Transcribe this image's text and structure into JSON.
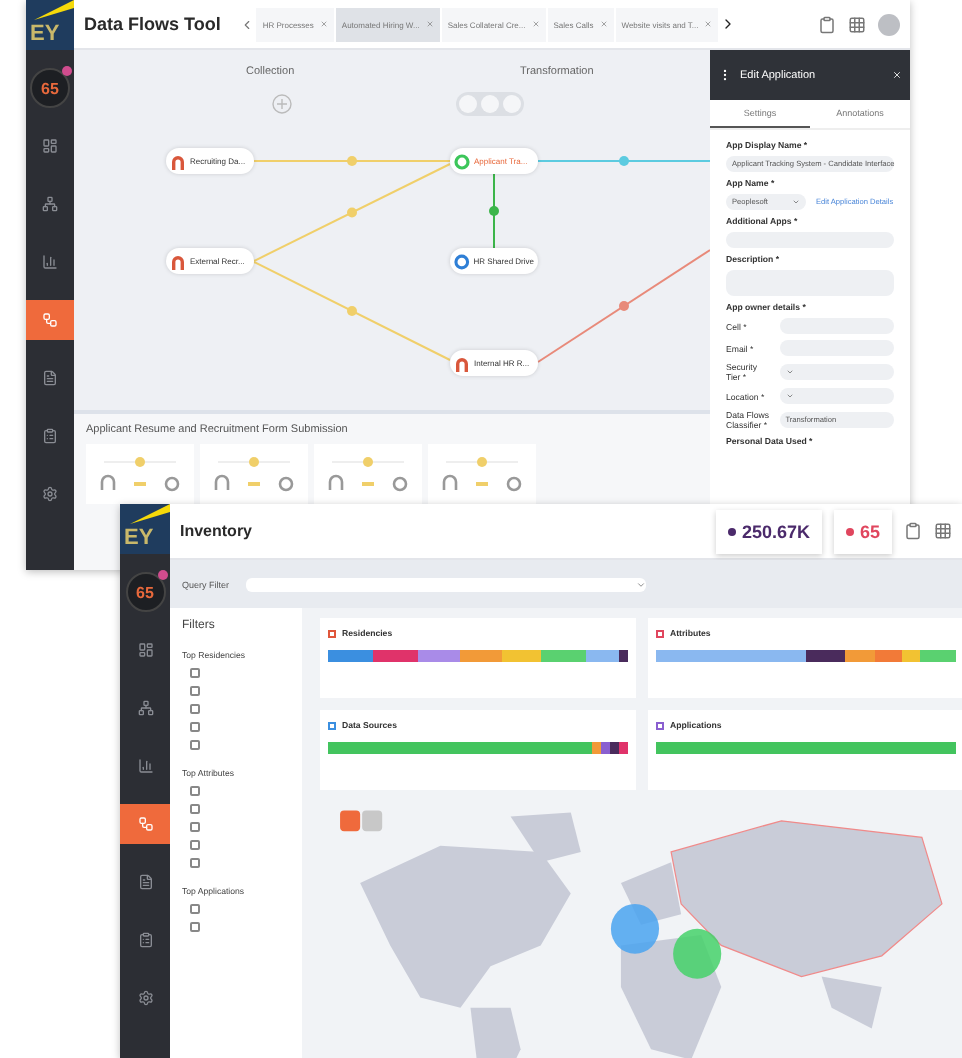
{
  "flows_window": {
    "logo": "EY",
    "badge_count": "65",
    "title": "Data Flows Tool",
    "tabs": [
      {
        "label": "HR Processes",
        "selected": false
      },
      {
        "label": "Automated Hiring W...",
        "selected": true
      },
      {
        "label": "Sales Collateral Cre...",
        "selected": false
      },
      {
        "label": "Sales Calls",
        "selected": false
      },
      {
        "label": "Website visits and T...",
        "selected": false
      }
    ],
    "columns": [
      "Collection",
      "Transformation"
    ],
    "nodes": [
      {
        "label": "Recruiting Da...",
        "kind": "person",
        "color": "#d9573b"
      },
      {
        "label": "Applicant Tra...",
        "kind": "app",
        "color": "#3cc65a"
      },
      {
        "label": "External Recr...",
        "kind": "person",
        "color": "#d9573b"
      },
      {
        "label": "HR Shared Drive",
        "kind": "app",
        "color": "#2f7fd6"
      },
      {
        "label": "Internal HR R...",
        "kind": "person",
        "color": "#d9573b"
      }
    ],
    "edges": [
      {
        "color": "#f0cf6a"
      },
      {
        "color": "#f0cf6a"
      },
      {
        "color": "#f0cf6a"
      },
      {
        "color": "#3cb54a"
      },
      {
        "color": "#5ccbe0"
      },
      {
        "color": "#e88a7a"
      }
    ],
    "panel": {
      "title": "Edit Application",
      "tabs": [
        {
          "label": "Settings",
          "selected": true
        },
        {
          "label": "Annotations",
          "selected": false
        }
      ],
      "fields": [
        {
          "kind": "text",
          "label": "App Display Name *",
          "value": "Applicant Tracking System - Candidate Interface"
        },
        {
          "kind": "select",
          "label": "App Name *",
          "value": "Peoplesoft",
          "link": "Edit Application Details"
        },
        {
          "kind": "text",
          "label": "Additional Apps *"
        },
        {
          "kind": "area",
          "label": "Description *"
        },
        {
          "kind": "heading",
          "label": "App owner details *"
        },
        {
          "kind": "inline",
          "label": "Cell *"
        },
        {
          "kind": "inline",
          "label": "Email *"
        },
        {
          "kind": "inline-select",
          "label": "Security Tier *"
        },
        {
          "kind": "inline-select",
          "label": "Location *"
        },
        {
          "kind": "inline",
          "label": "Data Flows Classifier *",
          "value": "Transformation"
        },
        {
          "kind": "heading",
          "label": "Personal Data Used *"
        }
      ]
    },
    "section_title": "Applicant Resume and Recruitment Form Submission"
  },
  "inventory_window": {
    "logo": "EY",
    "badge_count": "65",
    "title": "Inventory",
    "stats": [
      {
        "value": "250.67K",
        "color": "#4b2a6b"
      },
      {
        "value": "65",
        "color": "#e0465e"
      }
    ],
    "query_label": "Query Filter",
    "filters_title": "Filters",
    "filter_groups": [
      {
        "title": "Top Residencies",
        "options": [
          {
            "checked": false
          },
          {
            "checked": false
          },
          {
            "checked": false
          },
          {
            "checked": false
          },
          {
            "checked": false
          }
        ]
      },
      {
        "title": "Top Attributes",
        "options": [
          {
            "checked": false
          },
          {
            "checked": false
          },
          {
            "checked": false
          },
          {
            "checked": false
          },
          {
            "checked": false
          }
        ]
      },
      {
        "title": "Top Applications",
        "options": [
          {
            "checked": false
          },
          {
            "checked": false
          }
        ]
      }
    ],
    "cards": [
      {
        "title": "Residencies",
        "color": "#e0563b"
      },
      {
        "title": "Attributes",
        "color": "#e0465e"
      },
      {
        "title": "Data Sources",
        "color": "#3b8fe0"
      },
      {
        "title": "Applications",
        "color": "#8a5fd0"
      }
    ]
  }
}
